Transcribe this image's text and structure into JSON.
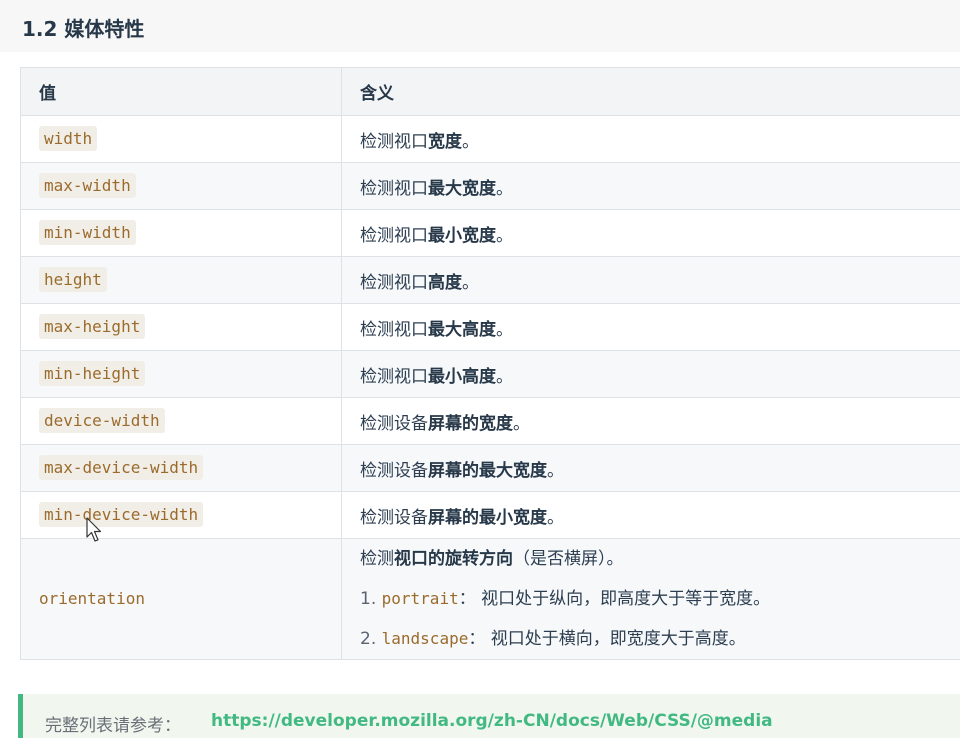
{
  "section": {
    "title": "1.2 媒体特性"
  },
  "table": {
    "headers": [
      "值",
      "含义"
    ],
    "rows": [
      {
        "value": "width",
        "prefix": "检测视口",
        "bold": "宽度",
        "suffix": "。"
      },
      {
        "value": "max-width",
        "prefix": "检测视口",
        "bold": "最大宽度",
        "suffix": "。"
      },
      {
        "value": "min-width",
        "prefix": "检测视口",
        "bold": "最小宽度",
        "suffix": "。"
      },
      {
        "value": "height",
        "prefix": "检测视口",
        "bold": "高度",
        "suffix": "。"
      },
      {
        "value": "max-height",
        "prefix": "检测视口",
        "bold": "最大高度",
        "suffix": "。"
      },
      {
        "value": "min-height",
        "prefix": "检测视口",
        "bold": "最小高度",
        "suffix": "。"
      },
      {
        "value": "device-width",
        "prefix": "检测设备",
        "bold": "屏幕的宽度",
        "suffix": "。"
      },
      {
        "value": "max-device-width",
        "prefix": "检测设备",
        "bold": "屏幕的最大宽度",
        "suffix": "。"
      },
      {
        "value": "min-device-width",
        "prefix": "检测设备",
        "bold": "屏幕的最小宽度",
        "suffix": "。"
      }
    ],
    "orientation": {
      "value": "orientation",
      "prefix": "检测",
      "bold": "视口的旋转方向",
      "suffix": "（是否横屏）。",
      "items": [
        {
          "num": "1.",
          "code": "portrait",
          "text": "：  视口处于纵向，即高度大于等于宽度。"
        },
        {
          "num": "2.",
          "code": "landscape",
          "text": "：  视口处于横向，即宽度大于高度。"
        }
      ]
    }
  },
  "note": {
    "label": "完整列表请参考：",
    "link": "https://developer.mozilla.org/zh-CN/docs/Web/CSS/@media"
  }
}
